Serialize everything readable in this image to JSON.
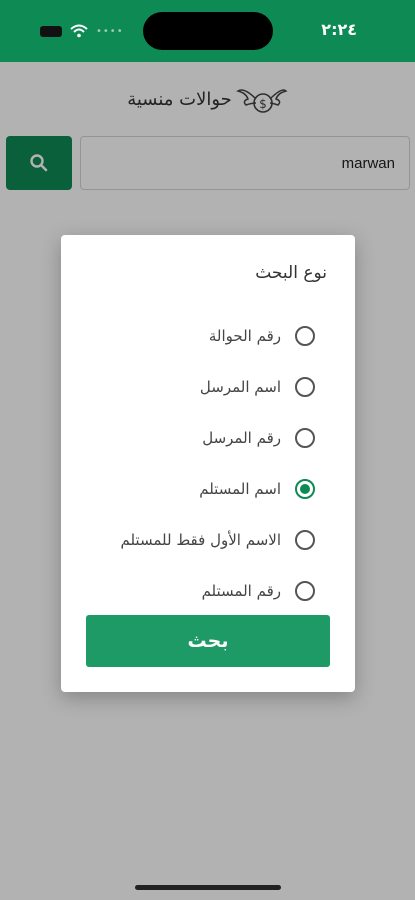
{
  "status_bar": {
    "time": "٢:٢٤"
  },
  "header": {
    "title": "حوالات منسية"
  },
  "search": {
    "value": "marwan"
  },
  "dialog": {
    "title": "نوع البحث",
    "options": [
      {
        "label": "رقم الحوالة",
        "checked": false
      },
      {
        "label": "اسم المرسل",
        "checked": false
      },
      {
        "label": "رقم المرسل",
        "checked": false
      },
      {
        "label": "اسم المستلم",
        "checked": true
      },
      {
        "label": "الاسم الأول فقط للمستلم",
        "checked": false
      },
      {
        "label": "رقم المستلم",
        "checked": false
      }
    ],
    "submit_label": "بحث"
  },
  "colors": {
    "primary": "#0e8a55",
    "button": "#1e9a66"
  }
}
